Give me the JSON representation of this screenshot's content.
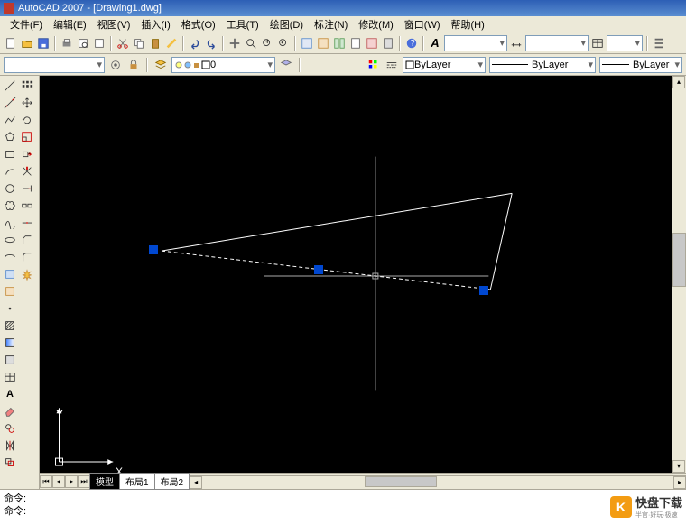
{
  "title": "AutoCAD 2007 - [Drawing1.dwg]",
  "menu": [
    "文件(F)",
    "编辑(E)",
    "视图(V)",
    "插入(I)",
    "格式(O)",
    "工具(T)",
    "绘图(D)",
    "标注(N)",
    "修改(M)",
    "窗口(W)",
    "帮助(H)"
  ],
  "layer": {
    "current": "0",
    "color_label": "ByLayer",
    "linetype_label": "ByLayer",
    "lineweight_label": "ByLayer"
  },
  "tabs": {
    "model": "模型",
    "layout1": "布局1",
    "layout2": "布局2"
  },
  "cmd": {
    "line1": "命令:",
    "line2": "命令:"
  },
  "ucs": {
    "x": "X",
    "y": "Y"
  },
  "watermark": {
    "logo": "K",
    "text": "快盘下载",
    "sub": "半官·好玩·极速"
  }
}
